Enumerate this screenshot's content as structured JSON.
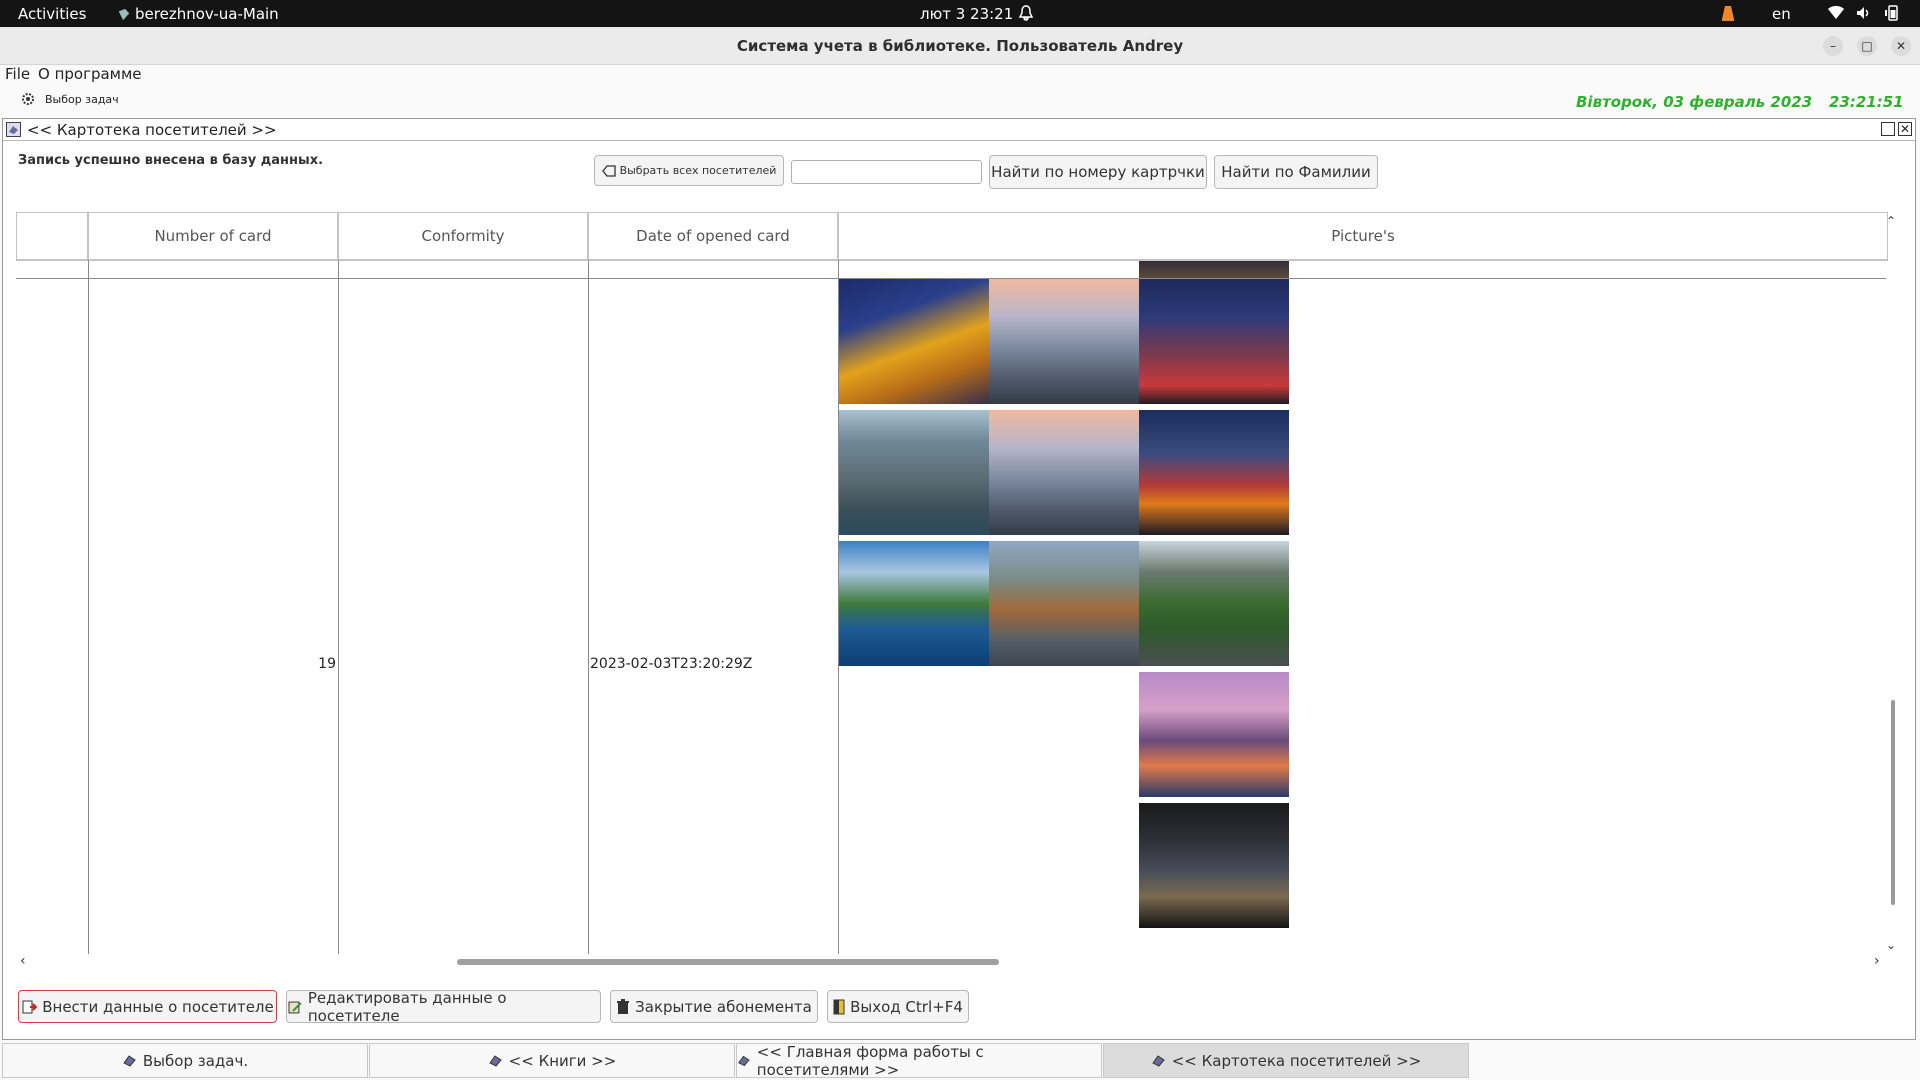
{
  "topbar": {
    "activities": "Activities",
    "app_name": "berezhnov-ua-Main",
    "datetime": "лют 3  23:21",
    "lang": "en"
  },
  "window": {
    "title": "Система учета в библиотеке. Пользователь Andrey"
  },
  "menu": {
    "file": "File",
    "about": "О программе"
  },
  "toolbar": {
    "task_select": "Выбор задач",
    "date": "Вівторок, 03 февраль 2023",
    "time": "23:21:51",
    "date_color": "#2fb02f"
  },
  "frame": {
    "title": "<< Картотека посетителей >>",
    "status": "Запись успешно внесена в базу данных.",
    "select_all": "Выбрать всех посетителей",
    "search_value": "",
    "find_by_card": "Найти по номеру картрчки",
    "find_by_surname": "Найти по Фамилии"
  },
  "table": {
    "columns": [
      "",
      "Number of card",
      "Conformity",
      "Date of opened card",
      "Picture's"
    ],
    "row": {
      "number": "19",
      "conformity": "",
      "date": "2023-02-03T23:20:29Z"
    }
  },
  "actions": {
    "add": "Внести данные о посетителе",
    "edit": "Редактировать данные о посетителе",
    "close_sub": "Закрытие абонемента",
    "exit": "Выход Ctrl+F4"
  },
  "tabs": [
    {
      "label": "Выбор задач."
    },
    {
      "label": "<< Книги >>"
    },
    {
      "label": "<< Главная форма работы с посетителями >>"
    },
    {
      "label": "<< Картотека посетителей >>"
    }
  ]
}
